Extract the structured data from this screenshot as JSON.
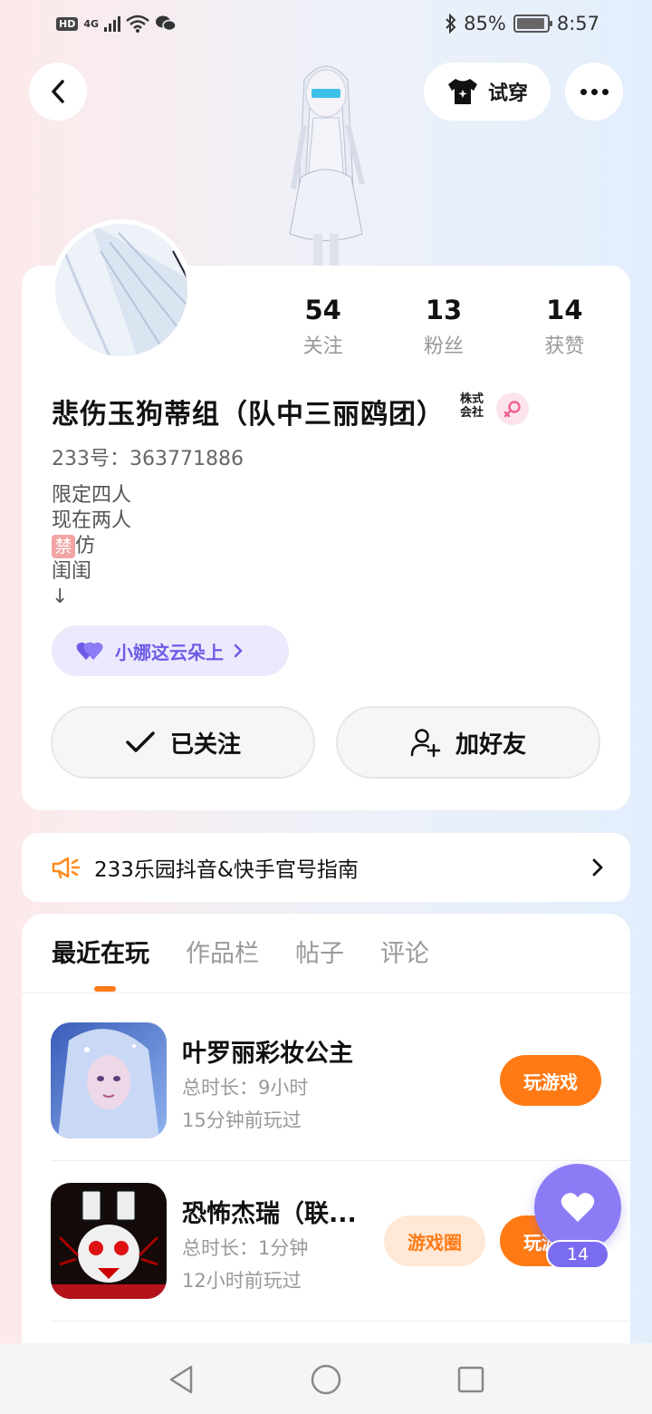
{
  "status_bar": {
    "hd": "HD",
    "network": "4G",
    "battery_percent": "85%",
    "time": "8:57"
  },
  "header": {
    "try_on_label": "试穿",
    "icons": [
      "back-icon",
      "shirt-icon",
      "more-icon"
    ]
  },
  "profile": {
    "stats": [
      {
        "num": "54",
        "label": "关注"
      },
      {
        "num": "13",
        "label": "粉丝"
      },
      {
        "num": "14",
        "label": "获赞"
      }
    ],
    "nickname": "悲伤玉狗蒂组（队中三丽鸥团）",
    "company_badge": "株式会社",
    "uid": "233号：363771886",
    "bio": [
      "限定四人",
      "现在两人",
      "仿",
      "闺闺",
      "↓"
    ],
    "bio_badge": "禁",
    "cloud_label": "小娜这云朵上",
    "follow_label": "已关注",
    "add_friend_label": "加好友"
  },
  "notice": {
    "text": "233乐园抖音&快手官号指南"
  },
  "tabs": [
    "最近在玩",
    "作品栏",
    "帖子",
    "评论"
  ],
  "games": [
    {
      "name": "叶罗丽彩妆公主",
      "duration": "总时长：9小时",
      "last_played": "15分钟前玩过",
      "play_label": "玩游戏"
    },
    {
      "name": "恐怖杰瑞（联...",
      "duration": "总时长：1分钟",
      "last_played": "12小时前玩过",
      "circle_label": "游戏圈",
      "play_label": "玩游戏"
    }
  ],
  "like_fab": {
    "count": "14"
  },
  "colors": {
    "accent": "#ff7a14",
    "purple": "#8b7cf6"
  }
}
